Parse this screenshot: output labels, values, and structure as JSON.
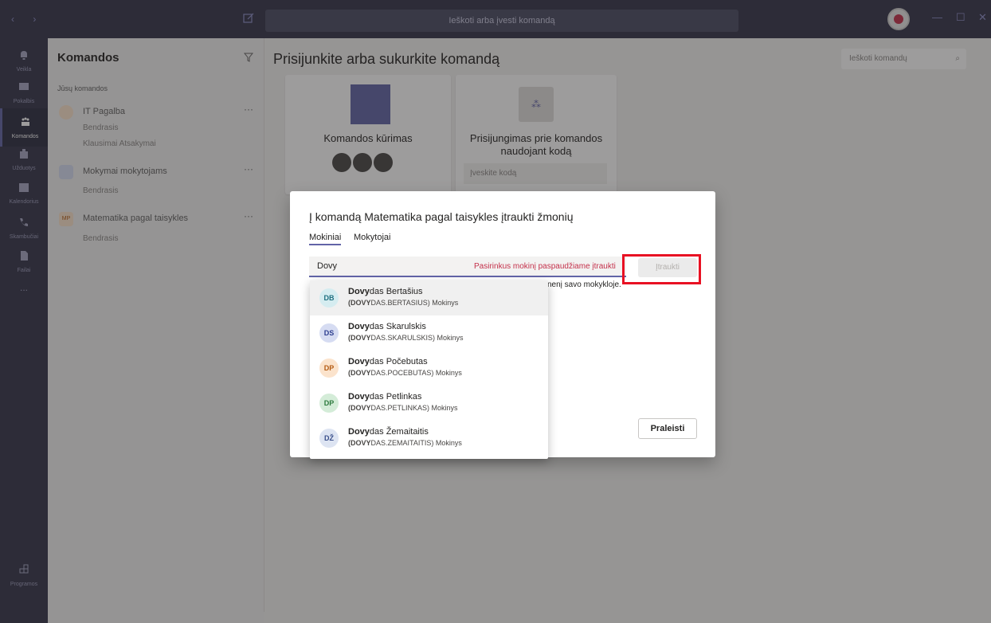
{
  "search_placeholder": "Ieškoti arba įvesti komandą",
  "rail": [
    {
      "label": "Veikla",
      "icon": "bell-icon"
    },
    {
      "label": "Pokalbis",
      "icon": "chat-icon"
    },
    {
      "label": "Komandos",
      "icon": "teams-icon"
    },
    {
      "label": "Užduotys",
      "icon": "assignments-icon"
    },
    {
      "label": "Kalendorius",
      "icon": "calendar-icon"
    },
    {
      "label": "Skambučiai",
      "icon": "phone-icon"
    },
    {
      "label": "Failai",
      "icon": "file-icon"
    },
    {
      "label": "...",
      "icon": "more-icon"
    },
    {
      "label": "Programos",
      "icon": "apps-icon"
    }
  ],
  "panel": {
    "title": "Komandos",
    "section": "Jūsų komandos",
    "teams": [
      {
        "name": "IT Pagalba",
        "avatar": "",
        "channels": [
          "Bendrasis",
          "Klausimai Atsakymai"
        ]
      },
      {
        "name": "Mokymai mokytojams",
        "avatar": "",
        "channels": [
          "Bendrasis"
        ]
      },
      {
        "name": "Matematika pagal taisykles",
        "avatar": "MP",
        "channels": [
          "Bendrasis"
        ]
      }
    ],
    "more": "···"
  },
  "main": {
    "title": "Prisijunkite arba sukurkite komandą",
    "search_teams": "Ieškoti komandų",
    "card1_title": "Komandos kūrimas",
    "card2_title_1": "Prisijungimas prie komandos",
    "card2_title_2": "naudojant kodą",
    "code_placeholder": "Įveskite kodą"
  },
  "modal": {
    "title": "Į komandą Matematika pagal taisykles įtraukti žmonių",
    "tabs": [
      "Mokiniai",
      "Mokytojai"
    ],
    "input_value": "Dovy",
    "hint": "Pasirinkus mokinį paspaudžiame įtraukti",
    "add_label": "Įtraukti",
    "info_text": "nenį savo mokykloje.",
    "skip_label": "Praleisti"
  },
  "suggestions": [
    {
      "initials": "DB",
      "bold": "Dovy",
      "rest": "das Bertašius",
      "sub_bold": "(DOVY",
      "sub_rest": "DAS.BERTASIUS) Mokinys",
      "bg": "#d5ecf0",
      "fg": "#1f6f80"
    },
    {
      "initials": "DS",
      "bold": "Dovy",
      "rest": "das Skarulskis",
      "sub_bold": "(DOVY",
      "sub_rest": "DAS.SKARULSKIS) Mokinys",
      "bg": "#d6dcf2",
      "fg": "#2d3e8f"
    },
    {
      "initials": "DP",
      "bold": "Dovy",
      "rest": "das Počebutas",
      "sub_bold": "(DOVY",
      "sub_rest": "DAS.POCEBUTAS) Mokinys",
      "bg": "#fbe3cc",
      "fg": "#b35a12"
    },
    {
      "initials": "DP",
      "bold": "Dovy",
      "rest": "das Petlinkas",
      "sub_bold": "(DOVY",
      "sub_rest": "DAS.PETLINKAS) Mokinys",
      "bg": "#d4ecd8",
      "fg": "#2d7a3e"
    },
    {
      "initials": "DŽ",
      "bold": "Dovy",
      "rest": "das Žemaitaitis",
      "sub_bold": "(DOVY",
      "sub_rest": "DAS.ZEMAITAITIS) Mokinys",
      "bg": "#dde4f2",
      "fg": "#3a4f8a"
    }
  ]
}
